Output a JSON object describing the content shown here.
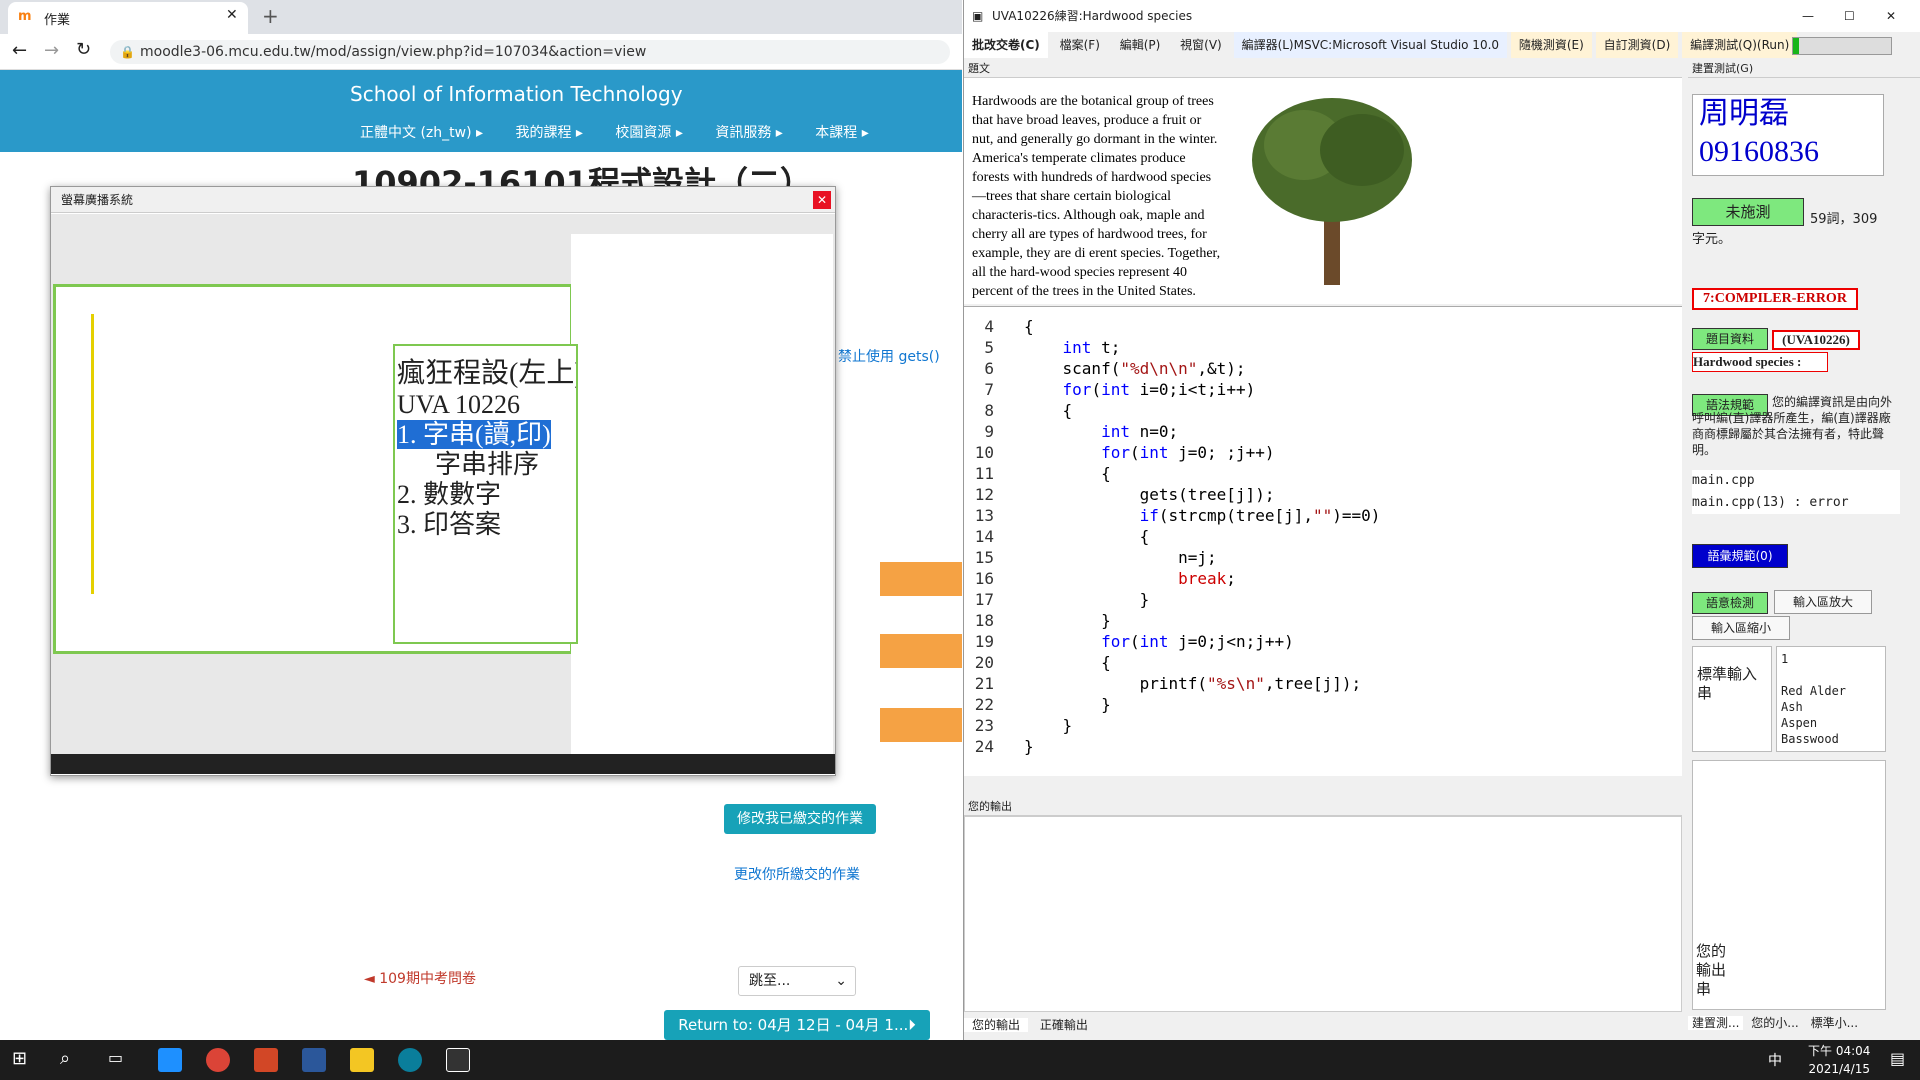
{
  "browser": {
    "tab_title": "作業",
    "url": "moodle3-06.mcu.edu.tw/mod/assign/view.php?id=107034&action=view",
    "site_title": "School of Information Technology",
    "nav": [
      "正體中文 (zh_tw) ▸",
      "我的課程 ▸",
      "校園資源 ▸",
      "資訊服務 ▸",
      "本課程 ▸"
    ],
    "course_title": "10902-16101程式設計（二）",
    "gets_note": "禁止使用 gets()",
    "edit_btn": "修改我已繳交的作業",
    "edit_link": "更改你所繳交的作業",
    "prev_link": "◄ 109期中考問卷",
    "jump_select": "跳至...",
    "return_btn": "Return to: 04月 12日 - 04月 1...⏵"
  },
  "popup": {
    "title": "螢幕廣播系統",
    "slide": {
      "line1": "瘋狂程設(左上)CPE顆星廣場",
      "line2": "UVA 10226",
      "items": [
        "1. 字串(讀,印)",
        "字串排序",
        "2. 數數字",
        "3. 印答案"
      ]
    }
  },
  "app": {
    "title": "UVA10226練習:Hardwood species",
    "menus": [
      "批改交卷(C)",
      "檔案(F)",
      "編輯(P)",
      "視窗(V)",
      "編譯器(L)MSVC:Microsoft Visual Studio 10.0",
      "隨機測資(E)",
      "自訂測資(D)",
      "編譯測試(Q)(Run)"
    ],
    "problem_hdr": "題文",
    "problem_text": "Hardwoods are the botanical group of trees that have broad leaves, produce a fruit or nut, and generally go dormant in the winter.\n    America's temperate climates produce forests with hundreds of hardwood species—trees that share certain biological characteris-tics. Although oak, maple and cherry all are types of hardwood trees, for example, they are di erent species. Together, all the hard-wood species represent 40 percent of the trees in the United States.",
    "code_lines": [
      {
        "n": "4",
        "t": "{"
      },
      {
        "n": "5",
        "t": "    int t;"
      },
      {
        "n": "6",
        "t": "    scanf(\"%d\\n\\n\",&t);"
      },
      {
        "n": "7",
        "t": "    for(int i=0;i<t;i++)"
      },
      {
        "n": "8",
        "t": "    {"
      },
      {
        "n": "9",
        "t": "        int n=0;"
      },
      {
        "n": "10",
        "t": "        for(int j=0; ;j++)"
      },
      {
        "n": "11",
        "t": "        {"
      },
      {
        "n": "12",
        "t": "            gets(tree[j]);"
      },
      {
        "n": "13",
        "t": "            if(strcmp(tree[j],\"\")==0)"
      },
      {
        "n": "14",
        "t": "            {"
      },
      {
        "n": "15",
        "t": "                n=j;"
      },
      {
        "n": "16",
        "t": "                break;"
      },
      {
        "n": "17",
        "t": "            }"
      },
      {
        "n": "18",
        "t": "        }"
      },
      {
        "n": "19",
        "t": "        for(int j=0;j<n;j++)"
      },
      {
        "n": "20",
        "t": "        {"
      },
      {
        "n": "21",
        "t": "            printf(\"%s\\n\",tree[j]);"
      },
      {
        "n": "22",
        "t": "        }"
      },
      {
        "n": "23",
        "t": "    }"
      },
      {
        "n": "24",
        "t": "}"
      }
    ],
    "output_hdr": "您的輸出",
    "bottom_tabs": [
      "您的輸出",
      "正確輸出"
    ],
    "sidebar": {
      "hdr": "建置測試(G)",
      "name": "周明磊",
      "id": "09160836",
      "status_btn": "未施測",
      "stats": "59詞，309字元。",
      "error": "7:COMPILER-ERROR",
      "info_btn": "題目資料",
      "uva": "(UVA10226)",
      "species": "Hardwood species :",
      "rules_btn": "語法規範",
      "rules_text": "您的編譯資訊是由向外呼叫編(直)譯器所產生，編(直)譯器廠商商標歸屬於其合法擁有者，特此聲明。",
      "file": "main.cpp",
      "err_line": "main.cpp(13) : error",
      "spec_btn": "語彙規範(0)",
      "check_btn": "語意檢測",
      "enlarge_btn": "輸入區放大",
      "shrink_btn": "輸入區縮小",
      "std_input_label": "標準輸入串",
      "std_input": [
        "1",
        "",
        "Red Alder",
        "Ash",
        "Aspen",
        "Basswood"
      ],
      "your_output_label": "您的輸出串",
      "bottom_tabs": [
        "建置測...",
        "您的小...",
        "標準小..."
      ]
    }
  },
  "taskbar": {
    "time": "下午 04:04",
    "date": "2021/4/15",
    "ime": "中"
  }
}
